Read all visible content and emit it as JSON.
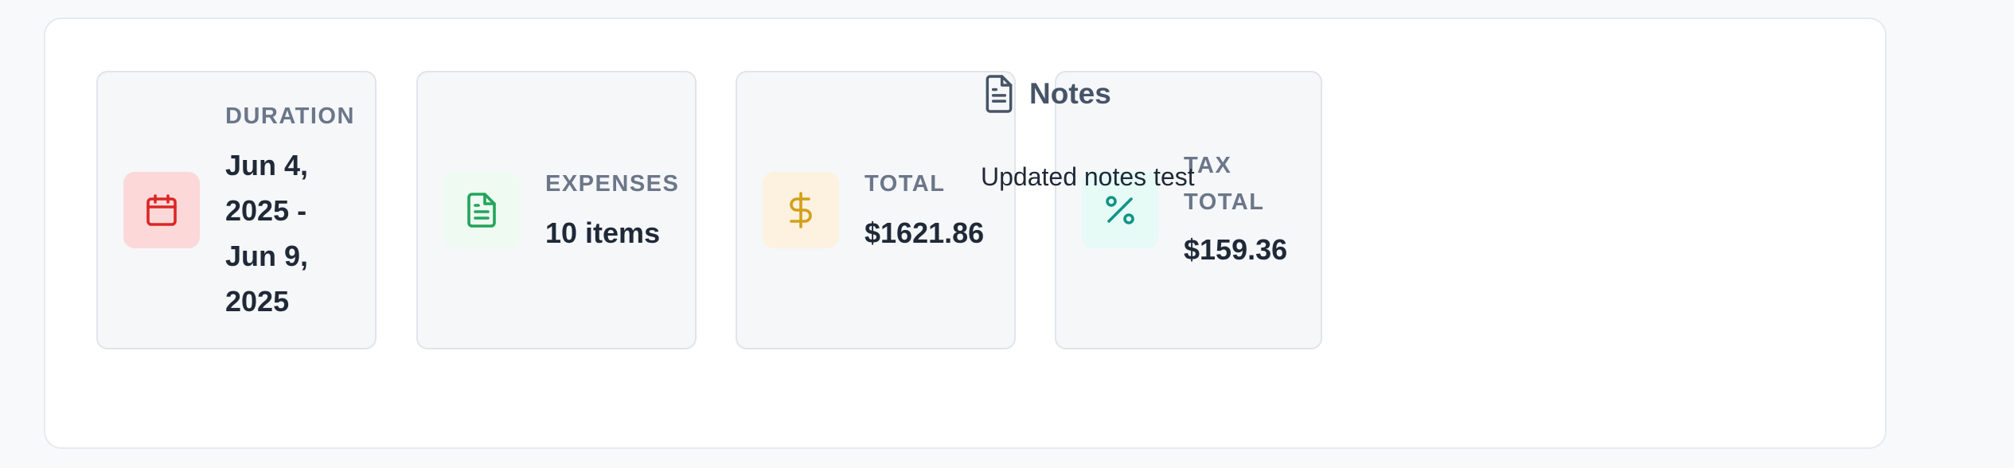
{
  "summary": {
    "cards": [
      {
        "label": "DURATION",
        "value": "Jun 4, 2025 - Jun 9, 2025",
        "value_lines": [
          "Jun 4,",
          "2025 -",
          "Jun 9,",
          "2025"
        ],
        "icon": "calendar-icon",
        "icon_color": "#dc2626",
        "icon_bg": "#fdd8d8"
      },
      {
        "label": "EXPENSES",
        "value": "10 items",
        "icon": "document-icon",
        "icon_color": "#22a55b",
        "icon_bg": "#eefaf2"
      },
      {
        "label": "TOTAL",
        "value": "$1621.86",
        "icon": "dollar-icon",
        "icon_color": "#d4a017",
        "icon_bg": "#fdf1e0"
      },
      {
        "label_lines": [
          "TAX",
          "TOTAL"
        ],
        "label": "TAX TOTAL",
        "value": "$159.36",
        "icon": "percent-icon",
        "icon_color": "#0f9488",
        "icon_bg": "#e6faf6"
      }
    ]
  },
  "notes": {
    "title": "Notes",
    "text": "Updated notes test",
    "icon": "document-icon"
  }
}
